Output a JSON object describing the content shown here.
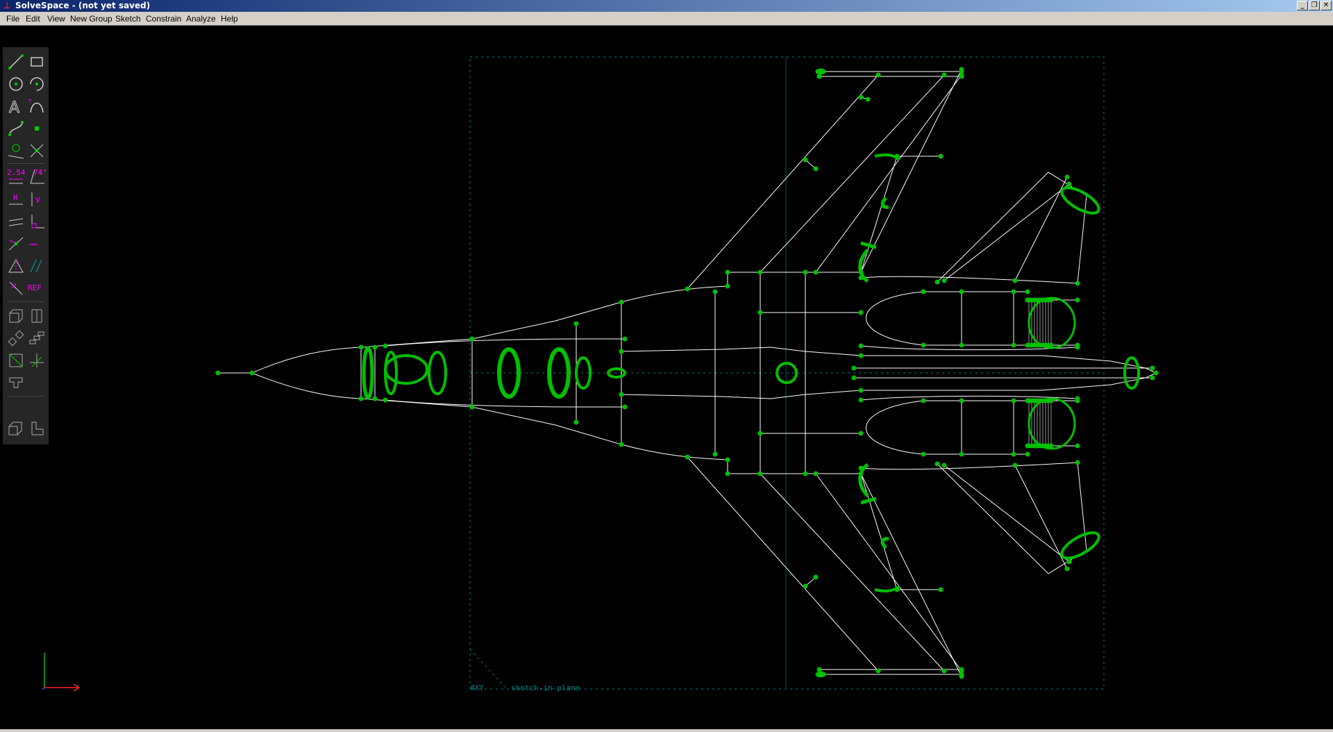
{
  "window": {
    "title": "SolveSpace - (not yet saved)"
  },
  "menu": [
    {
      "label": "File"
    },
    {
      "label": "Edit"
    },
    {
      "label": "View"
    },
    {
      "label": "New Group"
    },
    {
      "label": "Sketch"
    },
    {
      "label": "Constrain"
    },
    {
      "label": "Analyze"
    },
    {
      "label": "Help"
    }
  ],
  "toolbar": {
    "dimension_label": "2.54",
    "angle_label": "74°",
    "horizontal_label": "H",
    "vertical_label": "V",
    "reference_label": "REF",
    "tools": [
      {
        "name": "line-tool-icon"
      },
      {
        "name": "rectangle-tool-icon"
      },
      {
        "name": "circle-tool-icon"
      },
      {
        "name": "arc-tool-icon"
      },
      {
        "name": "text-tool-icon"
      },
      {
        "name": "tangent-arc-tool-icon"
      },
      {
        "name": "cubic-spline-tool-icon"
      },
      {
        "name": "datum-point-tool-icon"
      },
      {
        "name": "construction-toggle-icon"
      },
      {
        "name": "split-curves-icon"
      },
      {
        "name": "distance-constraint-icon"
      },
      {
        "name": "angle-constraint-icon"
      },
      {
        "name": "horizontal-constraint-icon"
      },
      {
        "name": "vertical-constraint-icon"
      },
      {
        "name": "parallel-constraint-icon"
      },
      {
        "name": "perpendicular-constraint-icon"
      },
      {
        "name": "point-on-entity-icon"
      },
      {
        "name": "equal-constraint-icon"
      },
      {
        "name": "symmetric-constraint-icon"
      },
      {
        "name": "same-orientation-icon"
      },
      {
        "name": "other-supplementary-icon"
      },
      {
        "name": "reference-toggle-icon"
      },
      {
        "name": "extrude-icon"
      },
      {
        "name": "lathe-icon"
      },
      {
        "name": "step-rotate-icon"
      },
      {
        "name": "step-translate-icon"
      },
      {
        "name": "sketch-in-plane-icon"
      },
      {
        "name": "sketch-in-3d-icon"
      },
      {
        "name": "link-import-icon"
      },
      {
        "name": "nearest-isometric-icon"
      },
      {
        "name": "nearest-ortho-icon"
      }
    ]
  },
  "workplane": {
    "label_plane": "#XY",
    "label_group": "sketch-in-plane"
  },
  "colors": {
    "background": "#000000",
    "geometry": "#ffffff",
    "points": "#00c000",
    "workplane": "#008080",
    "constraint": "#ff00ff"
  }
}
